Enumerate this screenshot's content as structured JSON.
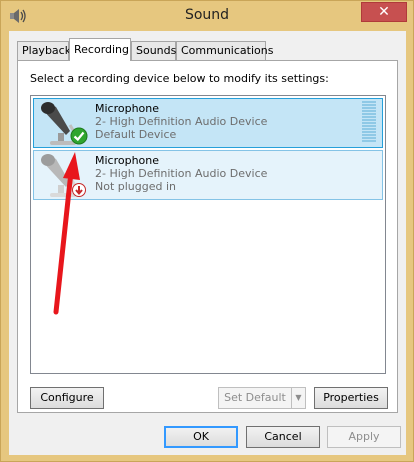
{
  "window": {
    "title": "Sound",
    "close_label": "✕"
  },
  "tabs": [
    {
      "label": "Playback",
      "active": false
    },
    {
      "label": "Recording",
      "active": true
    },
    {
      "label": "Sounds",
      "active": false
    },
    {
      "label": "Communications",
      "active": false
    }
  ],
  "panel": {
    "instruction": "Select a recording device below to modify its settings:"
  },
  "devices": [
    {
      "name": "Microphone",
      "description": "2- High Definition Audio Device",
      "status": "Default Device",
      "status_icon": "green-check-icon",
      "selected": true
    },
    {
      "name": "Microphone",
      "description": "2- High Definition Audio Device",
      "status": "Not plugged in",
      "status_icon": "red-down-arrow-icon",
      "selected": false
    }
  ],
  "buttons": {
    "configure": "Configure",
    "set_default": "Set Default",
    "properties": "Properties",
    "ok": "OK",
    "cancel": "Cancel",
    "apply": "Apply"
  },
  "colors": {
    "titlebar": "#e6c77f",
    "close": "#c75050",
    "selected_row": "#c4e5f6",
    "annotation_arrow": "#e8161c"
  }
}
